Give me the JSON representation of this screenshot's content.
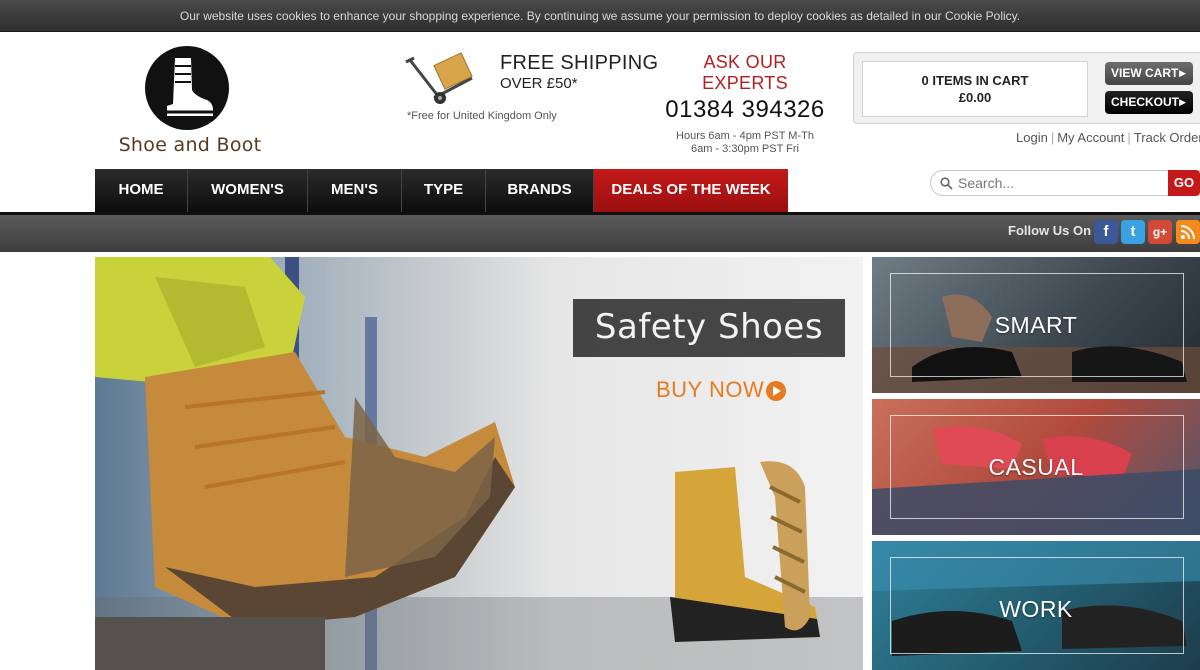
{
  "cookie_notice": "Our website uses cookies to enhance your shopping experience. By continuing we assume your permission to deploy cookies as detailed in our Cookie Policy.",
  "logo": {
    "text": "Shoe and Boot",
    "icon": "boot-logo-icon"
  },
  "shipping": {
    "icon": "hand-truck-icon",
    "title": "FREE SHIPPING",
    "subtitle": "OVER £50*",
    "note": "*Free for United Kingdom Only"
  },
  "experts": {
    "title": "ASK OUR EXPERTS",
    "phone": "01384 394326",
    "hours_line1": "Hours 6am - 4pm PST M-Th",
    "hours_line2": "6am - 3:30pm PST Fri"
  },
  "cart": {
    "items_text": "0 ITEMS IN CART",
    "total": "£0.00",
    "view_cart_label": "VIEW CART",
    "checkout_label": "CHECKOUT"
  },
  "account_links": {
    "login": "Login",
    "my_account": "My Account",
    "track_order": "Track Order"
  },
  "nav": {
    "items": [
      {
        "label": "HOME"
      },
      {
        "label": "WOMEN'S"
      },
      {
        "label": "MEN'S"
      },
      {
        "label": "TYPE"
      },
      {
        "label": "BRANDS"
      },
      {
        "label": "DEALS OF THE WEEK"
      }
    ]
  },
  "search": {
    "placeholder": "Search...",
    "go_label": "GO"
  },
  "social": {
    "label": "Follow Us On :",
    "facebook": "f",
    "twitter": "t",
    "google_plus": "g+",
    "rss": "rss"
  },
  "hero": {
    "title": "Safety Shoes",
    "cta": "BUY NOW"
  },
  "categories": [
    {
      "label": "SMART"
    },
    {
      "label": "CASUAL"
    },
    {
      "label": "WORK"
    }
  ],
  "colors": {
    "accent_red": "#c31919",
    "cta_orange": "#e67b1f",
    "brand_brown": "#5a3a1e"
  }
}
